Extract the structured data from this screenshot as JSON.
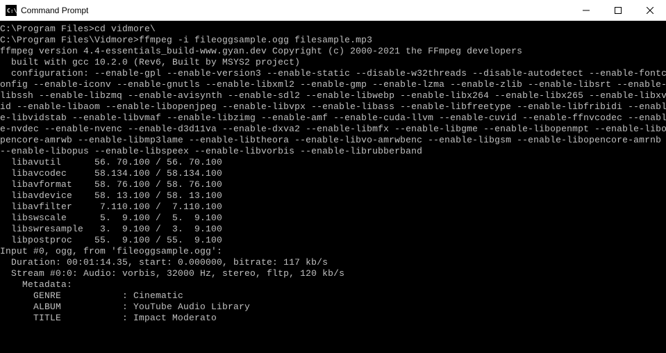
{
  "window": {
    "title": "Command Prompt",
    "icon_label": "C:\\"
  },
  "terminal": {
    "lines": [
      "C:\\Program Files>cd vidmore\\",
      "",
      "C:\\Program Files\\Vidmore>ffmpeg -i fileoggsample.ogg filesample.mp3",
      "ffmpeg version 4.4-essentials_build-www.gyan.dev Copyright (c) 2000-2021 the FFmpeg developers",
      "  built with gcc 10.2.0 (Rev6, Built by MSYS2 project)",
      "  configuration: --enable-gpl --enable-version3 --enable-static --disable-w32threads --disable-autodetect --enable-fontc",
      "onfig --enable-iconv --enable-gnutls --enable-libxml2 --enable-gmp --enable-lzma --enable-zlib --enable-libsrt --enable-",
      "libssh --enable-libzmq --enable-avisynth --enable-sdl2 --enable-libwebp --enable-libx264 --enable-libx265 --enable-libxv",
      "id --enable-libaom --enable-libopenjpeg --enable-libvpx --enable-libass --enable-libfreetype --enable-libfribidi --enabl",
      "e-libvidstab --enable-libvmaf --enable-libzimg --enable-amf --enable-cuda-llvm --enable-cuvid --enable-ffnvcodec --enabl",
      "e-nvdec --enable-nvenc --enable-d3d11va --enable-dxva2 --enable-libmfx --enable-libgme --enable-libopenmpt --enable-libo",
      "pencore-amrwb --enable-libmp3lame --enable-libtheora --enable-libvo-amrwbenc --enable-libgsm --enable-libopencore-amrnb ",
      "--enable-libopus --enable-libspeex --enable-libvorbis --enable-librubberband",
      "  libavutil      56. 70.100 / 56. 70.100",
      "  libavcodec     58.134.100 / 58.134.100",
      "  libavformat    58. 76.100 / 58. 76.100",
      "  libavdevice    58. 13.100 / 58. 13.100",
      "  libavfilter     7.110.100 /  7.110.100",
      "  libswscale      5.  9.100 /  5.  9.100",
      "  libswresample   3.  9.100 /  3.  9.100",
      "  libpostproc    55.  9.100 / 55.  9.100",
      "Input #0, ogg, from 'fileoggsample.ogg':",
      "  Duration: 00:01:14.35, start: 0.000000, bitrate: 117 kb/s",
      "  Stream #0:0: Audio: vorbis, 32000 Hz, stereo, fltp, 120 kb/s",
      "    Metadata:",
      "      GENRE           : Cinematic",
      "      ALBUM           : YouTube Audio Library",
      "      TITLE           : Impact Moderato"
    ]
  }
}
